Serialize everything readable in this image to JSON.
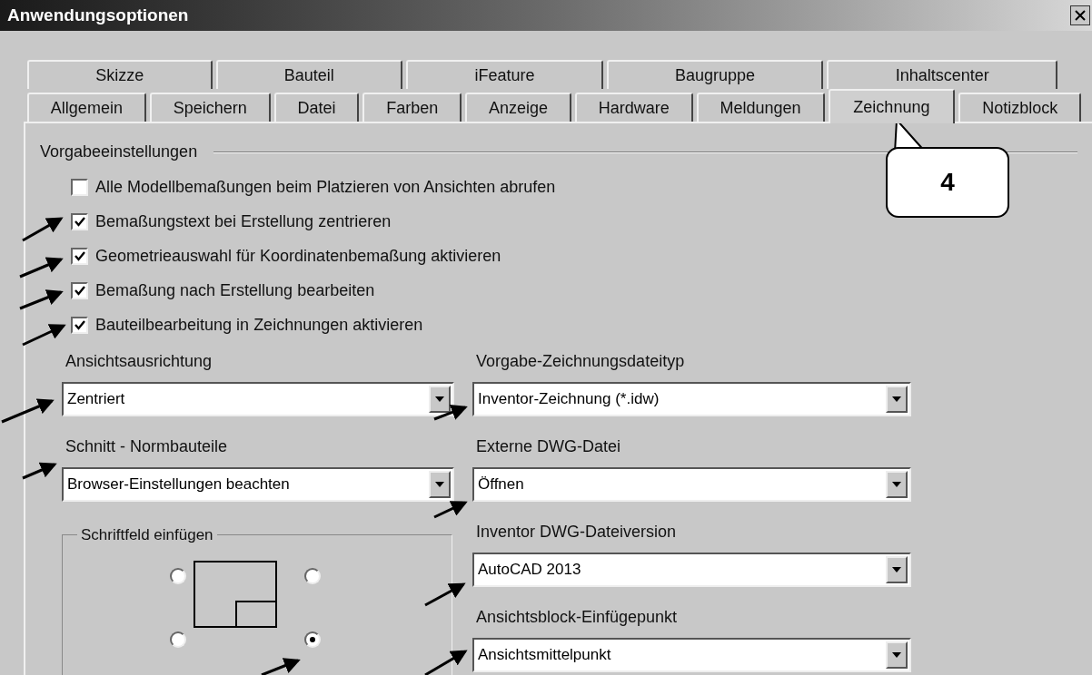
{
  "window": {
    "title": "Anwendungsoptionen"
  },
  "tab_row_upper": [
    {
      "label": "Skizze",
      "selected": false
    },
    {
      "label": "Bauteil",
      "selected": false
    },
    {
      "label": "iFeature",
      "selected": false
    },
    {
      "label": "Baugruppe",
      "selected": false
    },
    {
      "label": "Inhaltscenter",
      "selected": false
    }
  ],
  "tab_row_lower": [
    {
      "label": "Allgemein",
      "selected": false
    },
    {
      "label": "Speichern",
      "selected": false
    },
    {
      "label": "Datei",
      "selected": false
    },
    {
      "label": "Farben",
      "selected": false
    },
    {
      "label": "Anzeige",
      "selected": false
    },
    {
      "label": "Hardware",
      "selected": false
    },
    {
      "label": "Meldungen",
      "selected": false
    },
    {
      "label": "Zeichnung",
      "selected": true
    },
    {
      "label": "Notizblock",
      "selected": false
    }
  ],
  "section": {
    "title": "Vorgabeeinstellungen"
  },
  "checkboxes": [
    {
      "label": "Alle Modellbemaßungen beim Platzieren von Ansichten abrufen",
      "checked": false
    },
    {
      "label": "Bemaßungstext bei Erstellung zentrieren",
      "checked": true
    },
    {
      "label": "Geometrieauswahl für Koordinatenbemaßung aktivieren",
      "checked": true
    },
    {
      "label": "Bemaßung nach Erstellung bearbeiten",
      "checked": true
    },
    {
      "label": "Bauteilbearbeitung in Zeichnungen aktivieren",
      "checked": true
    }
  ],
  "left_dropdowns": [
    {
      "label": "Ansichtsausrichtung",
      "value": "Zentriert"
    },
    {
      "label": "Schnitt - Normbauteile",
      "value": "Browser-Einstellungen beachten"
    }
  ],
  "right_dropdowns": [
    {
      "label": "Vorgabe-Zeichnungsdateityp",
      "value": "Inventor-Zeichnung (*.idw)"
    },
    {
      "label": "Externe DWG-Datei",
      "value": "Öffnen"
    },
    {
      "label": "Inventor DWG-Dateiversion",
      "value": "AutoCAD 2013"
    },
    {
      "label": "Ansichtsblock-Einfügepunkt",
      "value": "Ansichtsmittelpunkt"
    }
  ],
  "title_block_group": {
    "title": "Schriftfeld einfügen",
    "radios": [
      {
        "selected": false
      },
      {
        "selected": false
      },
      {
        "selected": false
      },
      {
        "selected": true
      }
    ]
  },
  "callout": {
    "text": "4"
  }
}
